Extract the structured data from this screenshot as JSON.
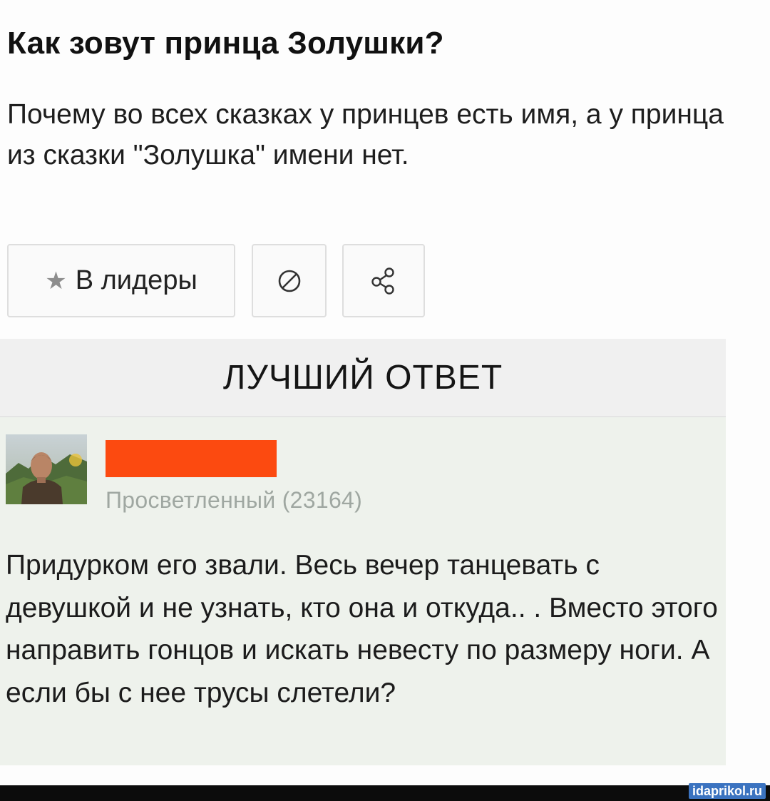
{
  "question": {
    "title": "Как зовут принца Золушки?",
    "body": "Почему во всех сказках у принцев есть имя, а у принца из сказки \"Золушка\" имени нет."
  },
  "actions": {
    "leaders_label": "В лидеры",
    "leaders_icon": "star-icon",
    "block_icon": "block-icon",
    "share_icon": "share-icon"
  },
  "best_answer": {
    "header": "ЛУЧШИЙ ОТВЕТ",
    "user": {
      "rank": "Просветленный (23164)"
    },
    "text": "Придурком его звали. Весь вечер танцевать с девушкой и не узнать, кто она и откуда.. . Вместо этого направить гонцов и искать невесту по размеру ноги. А если бы с нее трусы слетели?"
  },
  "watermark": "idaprikol.ru",
  "colors": {
    "redaction": "#fc4a10",
    "answer_background": "#eef2ec",
    "header_background": "#f0f0f0",
    "watermark_background": "#3b73c0"
  }
}
